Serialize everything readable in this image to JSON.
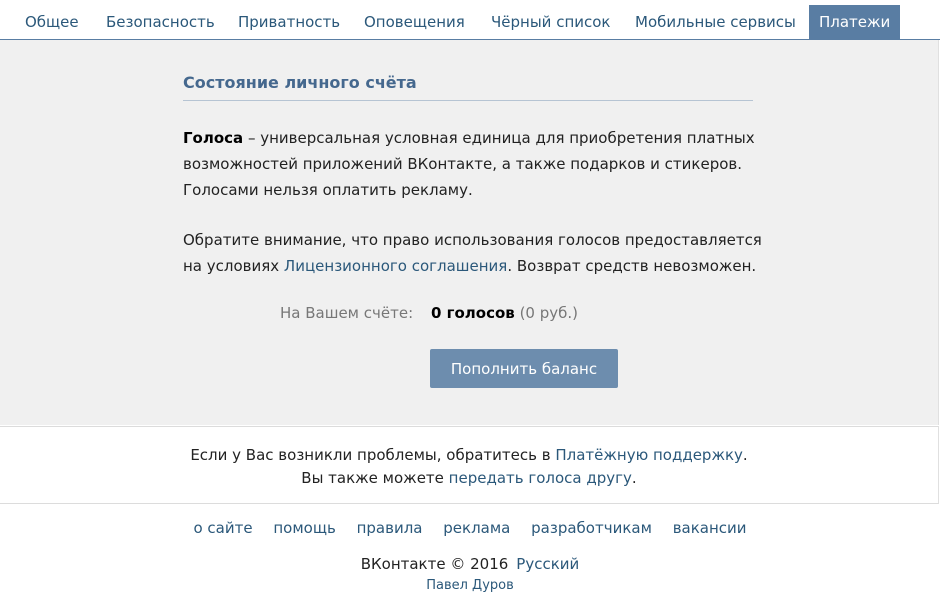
{
  "tabs": [
    {
      "label": "Общее"
    },
    {
      "label": "Безопасность"
    },
    {
      "label": "Приватность"
    },
    {
      "label": "Оповещения"
    },
    {
      "label": "Чёрный список"
    },
    {
      "label": "Мобильные сервисы"
    },
    {
      "label": "Платежи",
      "active": true
    }
  ],
  "section": {
    "title": "Состояние личного счёта",
    "para1_bold": "Голоса",
    "para1_rest": " – универсальная условная единица для приобретения платных возможностей приложений ВКонтакте, а также подарков и стикеров. Голосами нельзя оплатить рекламу.",
    "para2_before": "Обратите внимание, что право использования голосов предоставляется на условиях ",
    "para2_link": "Лицензионного соглашения",
    "para2_after": ". Возврат средств невозможен.",
    "balance_label": "На Вашем счёте:",
    "balance_votes": "0 голосов",
    "balance_rub": "(0 руб.)",
    "topup_button": "Пополнить баланс"
  },
  "support": {
    "line1_before": "Если у Вас возникли проблемы, обратитесь в ",
    "line1_link": "Платёжную поддержку",
    "line1_after": ".",
    "line2_before": "Вы также можете ",
    "line2_link": "передать голоса другу",
    "line2_after": "."
  },
  "footer": {
    "links": [
      "о сайте",
      "помощь",
      "правила",
      "реклама",
      "разработчикам",
      "вакансии"
    ],
    "copyright": "ВКонтакте © 2016",
    "language": "Русский",
    "author": "Павел Дуров"
  },
  "colors": {
    "accent": "#597da3",
    "link": "#2b587a",
    "panel_bg": "#f0f0f0",
    "button_bg": "#6d8dae"
  }
}
